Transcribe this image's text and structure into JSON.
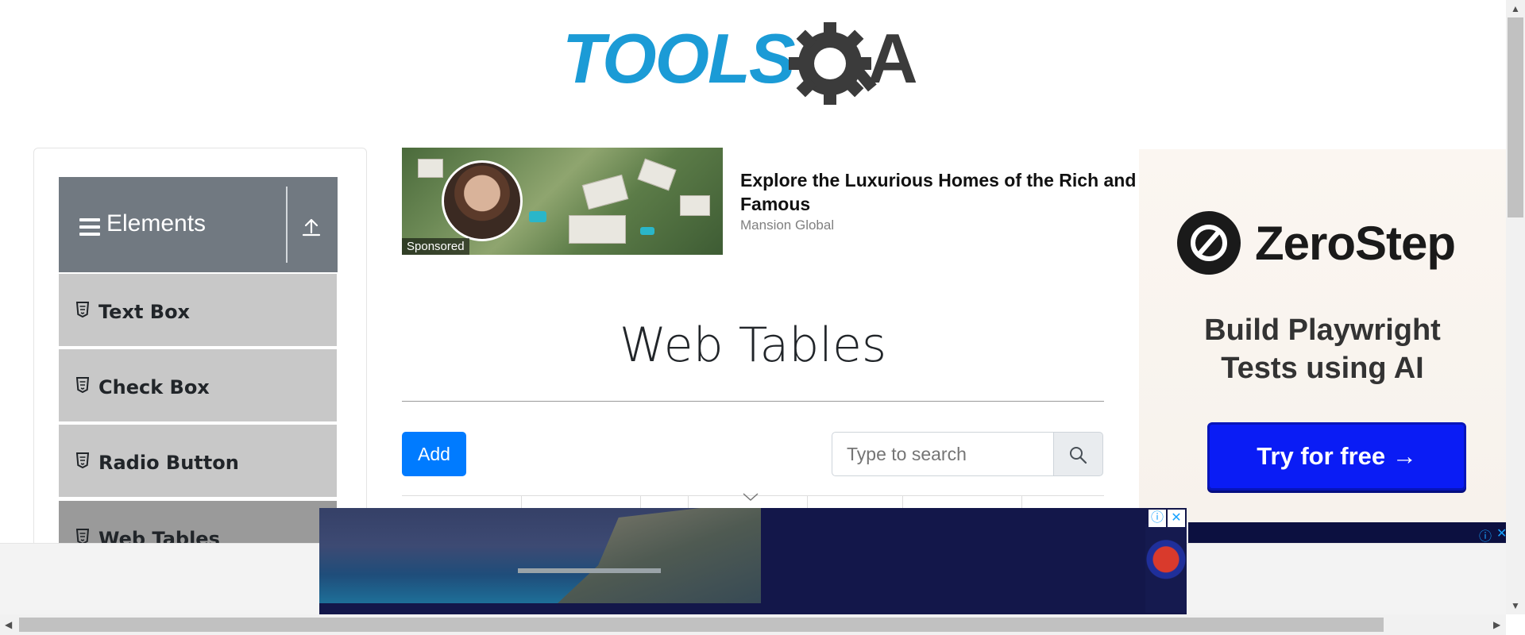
{
  "logo": {
    "text_tools": "TOOLS",
    "text_qa": "QA",
    "colors": {
      "tools": "#1b9bd6",
      "qa": "#3b3b3b"
    }
  },
  "sidebar": {
    "group_title": "Elements",
    "items": [
      {
        "label": "Text Box"
      },
      {
        "label": "Check Box"
      },
      {
        "label": "Radio Button"
      },
      {
        "label": "Web Tables"
      }
    ]
  },
  "sponsored_ad": {
    "tag": "Sponsored",
    "title": "Explore the Luxurious Homes of the Rich and Famous",
    "source": "Mansion Global"
  },
  "main": {
    "title": "Web Tables",
    "add_label": "Add",
    "search_placeholder": "Type to search"
  },
  "side_ad": {
    "brand": "ZeroStep",
    "tagline": "Build Playwright Tests using AI",
    "cta": "Try for free →"
  },
  "bottom_ad": {
    "info_icon": "ⓘ",
    "close_icon": "✕"
  },
  "colors": {
    "primary": "#007bff",
    "sidebar_header": "#717981",
    "menu_item": "#c8c8c8"
  }
}
